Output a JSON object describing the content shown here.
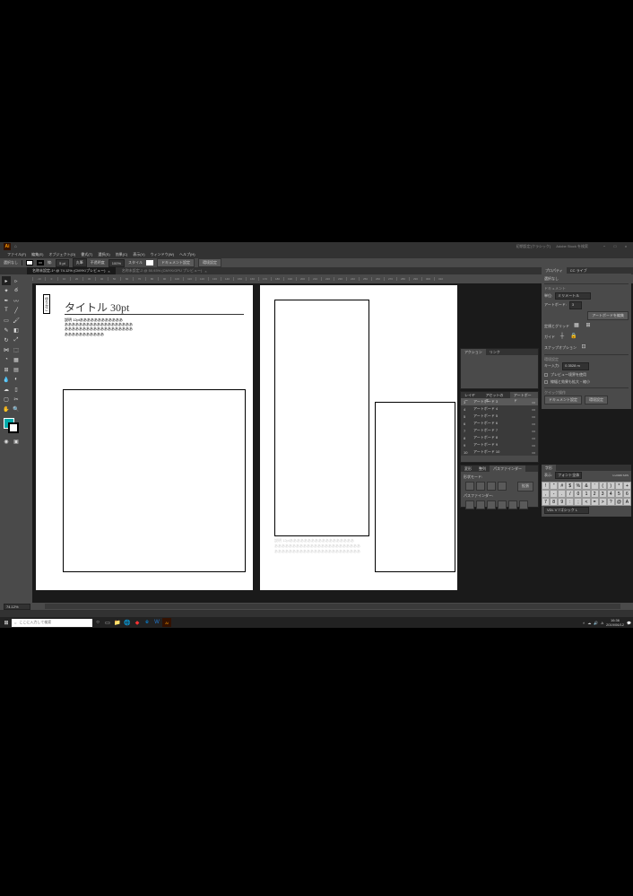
{
  "titlebar": {
    "workspace": "初期設定(クラシック)",
    "search": "Adobe Stock を検索"
  },
  "menu": [
    "ファイル(F)",
    "編集(E)",
    "オブジェクト(O)",
    "書式(T)",
    "選択(S)",
    "効果(C)",
    "表示(V)",
    "ウィンドウ(W)",
    "ヘルプ(H)"
  ],
  "ctrl": {
    "label1": "選択なし",
    "stroke": "5 pt",
    "brush": "丸筆",
    "opacity": "不透明度",
    "pct": "100%",
    "style": "スタイル",
    "docsetup": "ドキュメント設定",
    "prefs": "環境設定"
  },
  "tabs": [
    {
      "name": "名称未設定-1* @ 74.12% (CMYK/プレビュー)",
      "active": true
    },
    {
      "name": "名称未設定-2 @ 50.93% (CMYK/GPU プレビュー)",
      "active": false
    }
  ],
  "ruler_marks": [
    "-10",
    "0",
    "10",
    "20",
    "30",
    "40",
    "50",
    "60",
    "70",
    "80",
    "90",
    "100",
    "110",
    "120",
    "130",
    "140",
    "150",
    "160",
    "170",
    "180",
    "190",
    "200",
    "210",
    "220",
    "230",
    "240",
    "250",
    "260",
    "270",
    "280",
    "290",
    "300",
    "310"
  ],
  "doc": {
    "label": "ゆりかご",
    "title": "タイトル 30pt",
    "body1": "説明 12ptああああああああああああ",
    "body2": "あああああああああああああああああああ",
    "body3": "あああああああああああああああああああ",
    "body4": "あああああああああああ",
    "caption1": "説明 12ptああああああああああああああああああ",
    "caption2": "ああああああああああああああああああああああああ",
    "caption3": "ああああああああああああああああああああああああ"
  },
  "props": {
    "tab1": "プロパティ",
    "tab2": "CC ライブ",
    "sel_none": "選択なし",
    "section_doc": "ドキュメント",
    "units_lbl": "単位:",
    "units_val": "ミリメートル",
    "artboard_lbl": "アートボード:",
    "artboard_val": "3",
    "edit_ab": "アートボードを編集",
    "ruler_grid": "定規とグリッド",
    "guide": "ガイド",
    "snap": "スナップオプション",
    "section_env": "環境設定",
    "keyinc_lbl": "キー入力:",
    "keyinc_val": "0.3528 m",
    "preview": "プレビュー境界を使用",
    "scale": "線幅と効果も拡大・縮小",
    "quick": "クイック操作",
    "docset": "ドキュメント設定",
    "envset": "環境設定"
  },
  "actions": {
    "tab1": "アクション",
    "tab2": "リンク"
  },
  "artboards_panel": {
    "tab1": "レイヤー",
    "tab2": "アセットのエ",
    "tab3": "アートボード",
    "items": [
      {
        "n": "3",
        "name": "アートボード 3",
        "sel": true
      },
      {
        "n": "4",
        "name": "アートボード 4"
      },
      {
        "n": "5",
        "name": "アートボード 5"
      },
      {
        "n": "6",
        "name": "アートボード 6"
      },
      {
        "n": "7",
        "name": "アートボード 7"
      },
      {
        "n": "8",
        "name": "アートボード 8"
      },
      {
        "n": "9",
        "name": "アートボード 9"
      },
      {
        "n": "10",
        "name": "アートボード 10"
      }
    ]
  },
  "pathfinder": {
    "tab1": "変形",
    "tab2": "整列",
    "tab3": "パスファインダー",
    "shape_lbl": "形状モード:",
    "pf_lbl": "パスファインダー:",
    "expand": "拡張"
  },
  "glyphs": {
    "tab": "字形",
    "search": "フォント全体",
    "unicode": "U+0049 SJIS",
    "grid": [
      "!",
      "\"",
      "#",
      "$",
      "%",
      "&",
      "'",
      "(",
      ")",
      "*",
      "+",
      ",",
      "-",
      ".",
      "/",
      "0",
      "1",
      "2",
      "3",
      "4",
      "5",
      "6",
      "7",
      "8",
      "9",
      ":",
      ";",
      "<",
      "=",
      ">",
      "?",
      "@",
      "A"
    ],
    "font": "VDL V 7ゴシック L"
  },
  "status": {
    "zoom": "74.12%"
  },
  "taskbar": {
    "search": "ここに入力して検索",
    "time": "16:36",
    "date": "2019/06/12",
    "ime": "A"
  }
}
